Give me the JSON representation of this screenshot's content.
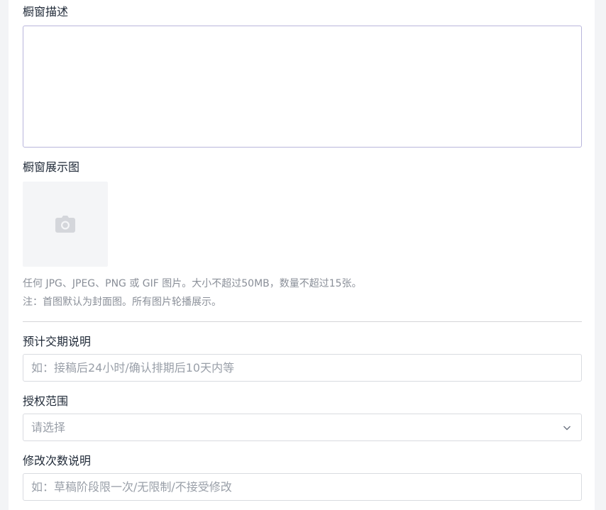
{
  "form": {
    "showcase_description": {
      "label": "橱窗描述",
      "value": ""
    },
    "showcase_image": {
      "label": "橱窗展示图",
      "upload_icon": "camera-icon",
      "hint_line1": "任何 JPG、JPEG、PNG 或 GIF 图片。大小不超过50MB，数量不超过15张。",
      "hint_line2": "注：首图默认为封面图。所有图片轮播展示。"
    },
    "delivery_note": {
      "label": "预计交期说明",
      "placeholder": "如：接稿后24小时/确认排期后10天内等"
    },
    "license_scope": {
      "label": "授权范围",
      "placeholder": "请选择",
      "icon": "chevron-down-icon"
    },
    "revision_note": {
      "label": "修改次数说明",
      "placeholder": "如：草稿阶段限一次/无限制/不接受修改"
    }
  },
  "colors": {
    "page_bg": "#f3f4f6",
    "panel_bg": "#ffffff",
    "focused_border": "#b9b6dc",
    "input_border": "#d9dbe0",
    "placeholder": "#999fa8",
    "hint": "#8a8f98"
  }
}
